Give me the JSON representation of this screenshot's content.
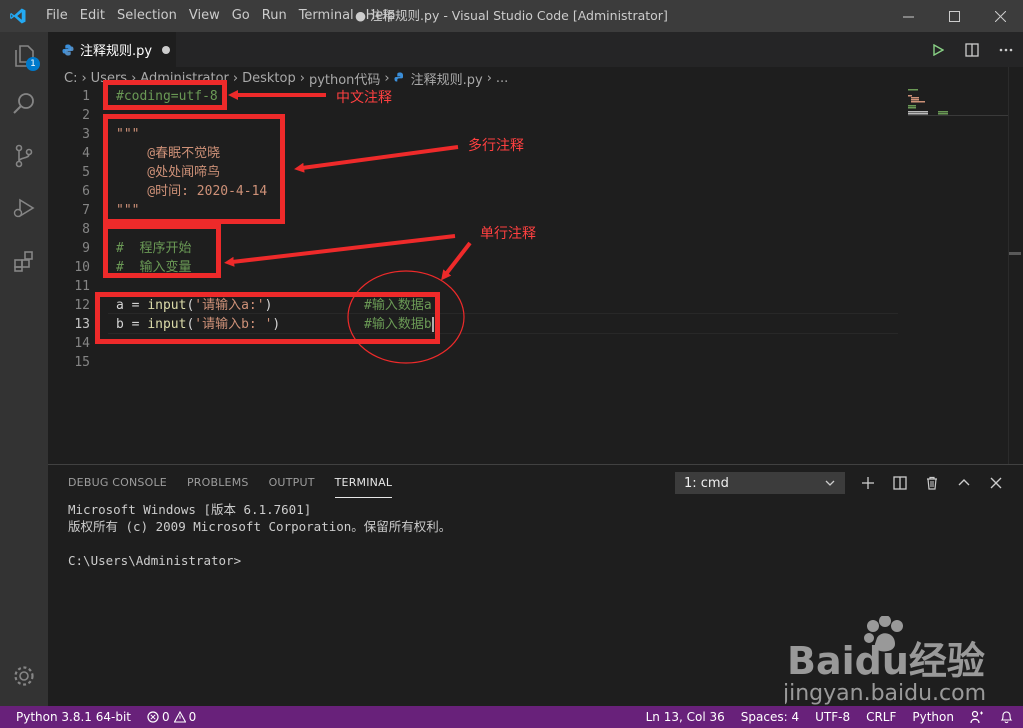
{
  "window": {
    "title": "● 注释规则.py - Visual Studio Code [Administrator]",
    "menu": [
      "File",
      "Edit",
      "Selection",
      "View",
      "Go",
      "Run",
      "Terminal",
      "Help"
    ]
  },
  "activity_bar": {
    "icons": [
      "explorer-icon",
      "search-icon",
      "source-control-icon",
      "run-debug-icon",
      "extensions-icon",
      "gear-icon"
    ],
    "explorer_badge": "1"
  },
  "tab": {
    "label": "注释规则.py"
  },
  "breadcrumb": [
    "C:",
    "Users",
    "Administrator",
    "Desktop",
    "python代码",
    "注释规则.py",
    "..."
  ],
  "code_lines": [
    {
      "n": "1"
    },
    {
      "n": "2"
    },
    {
      "n": "3"
    },
    {
      "n": "4"
    },
    {
      "n": "5"
    },
    {
      "n": "6"
    },
    {
      "n": "7"
    },
    {
      "n": "8"
    },
    {
      "n": "9"
    },
    {
      "n": "10"
    },
    {
      "n": "11"
    },
    {
      "n": "12"
    },
    {
      "n": "13"
    },
    {
      "n": "14"
    },
    {
      "n": "15"
    }
  ],
  "code": {
    "l1": "#coding=utf-8",
    "l3": "\"\"\"",
    "l4": "    @春眠不觉晓",
    "l5": "    @处处闻啼鸟",
    "l6": "    @时间: 2020-4-14",
    "l7": "\"\"\"",
    "l9": "#  程序开始",
    "l10": "#  输入变量",
    "l12_a": "a = ",
    "l12_fn": "input",
    "l12_p1": "(",
    "l12_str": "'请输入a:'",
    "l12_p2": ")",
    "l12_comment": "#输入数据a",
    "l13_a": "b = ",
    "l13_fn": "input",
    "l13_p1": "(",
    "l13_str": "'请输入b: '",
    "l13_p2": ")",
    "l13_comment": "#输入数据b"
  },
  "annotations": {
    "a1": "中文注释",
    "a2": "多行注释",
    "a3": "单行注释",
    "color": "#ee2a2a"
  },
  "panel": {
    "tabs": [
      "DEBUG CONSOLE",
      "PROBLEMS",
      "OUTPUT",
      "TERMINAL"
    ],
    "active_tab": "TERMINAL",
    "terminal_select": "1: cmd",
    "terminal_lines": [
      "Microsoft Windows [版本 6.1.7601]",
      "版权所有 (c) 2009 Microsoft Corporation。保留所有权利。",
      "",
      "C:\\Users\\Administrator>"
    ]
  },
  "statusbar": {
    "python": "Python 3.8.1 64-bit",
    "errors": "0",
    "warnings": "0",
    "position": "Ln 13, Col 36",
    "spaces": "Spaces: 4",
    "encoding": "UTF-8",
    "eol": "CRLF",
    "language": "Python",
    "color": "#68217a"
  },
  "watermark": {
    "brand": "Baidu经验",
    "url": "jingyan.baidu.com"
  }
}
